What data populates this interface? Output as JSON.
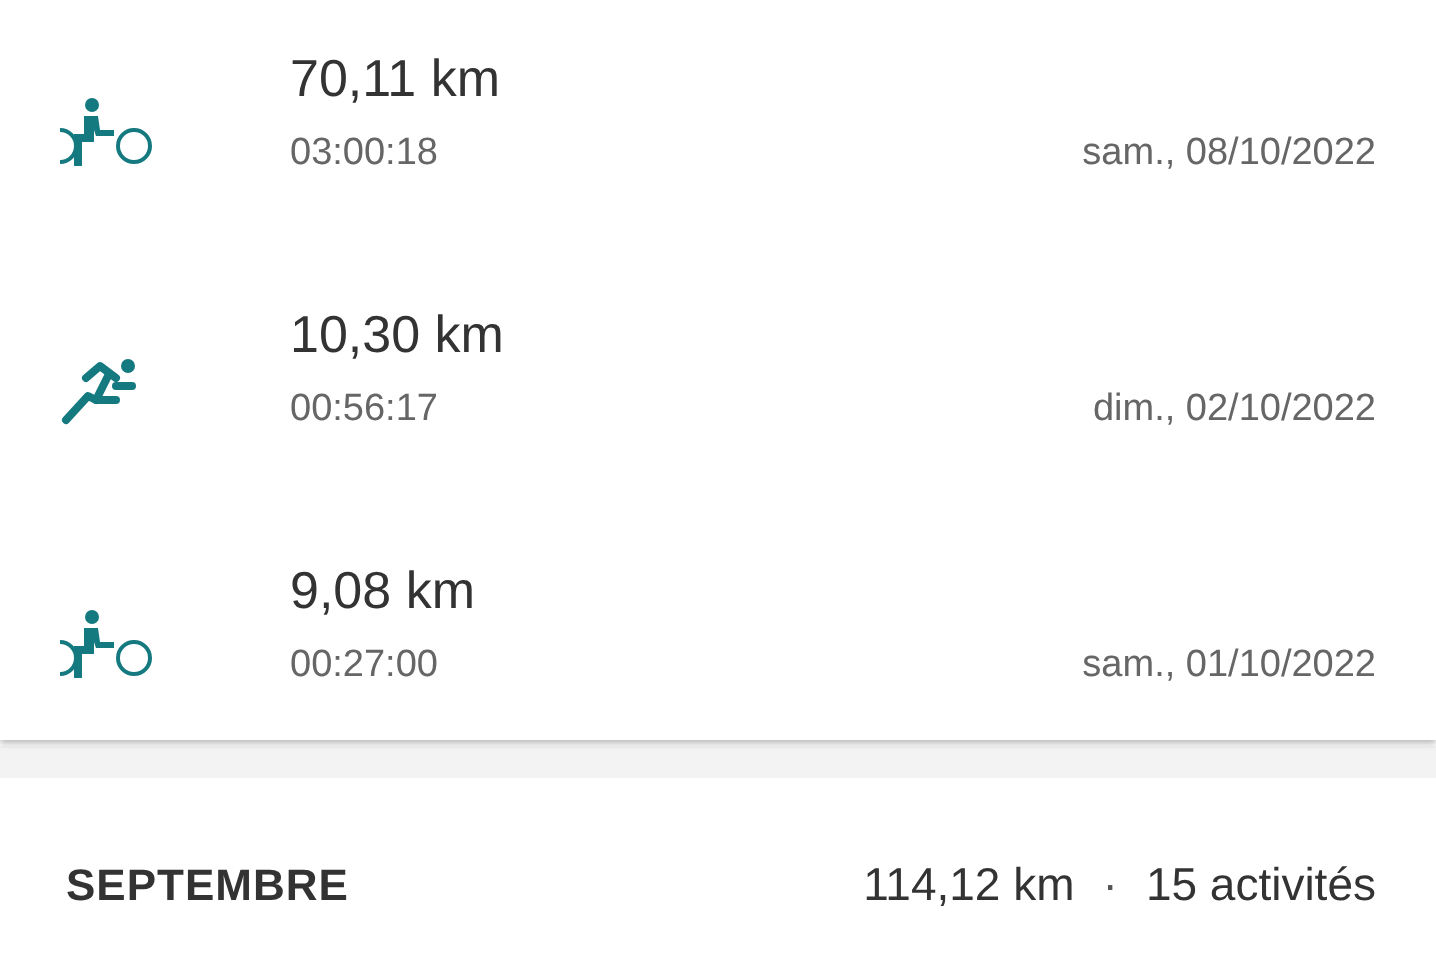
{
  "activities": [
    {
      "kind": "bike",
      "distance": "70,11 km",
      "duration": "03:00:18",
      "date": "sam., 08/10/2022"
    },
    {
      "kind": "run",
      "distance": "10,30 km",
      "duration": "00:56:17",
      "date": "dim., 02/10/2022"
    },
    {
      "kind": "bike",
      "distance": "9,08 km",
      "duration": "00:27:00",
      "date": "sam., 01/10/2022"
    }
  ],
  "month": {
    "name": "SEPTEMBRE",
    "distance": "114,12 km",
    "separator": "·",
    "count": "15 activités"
  }
}
